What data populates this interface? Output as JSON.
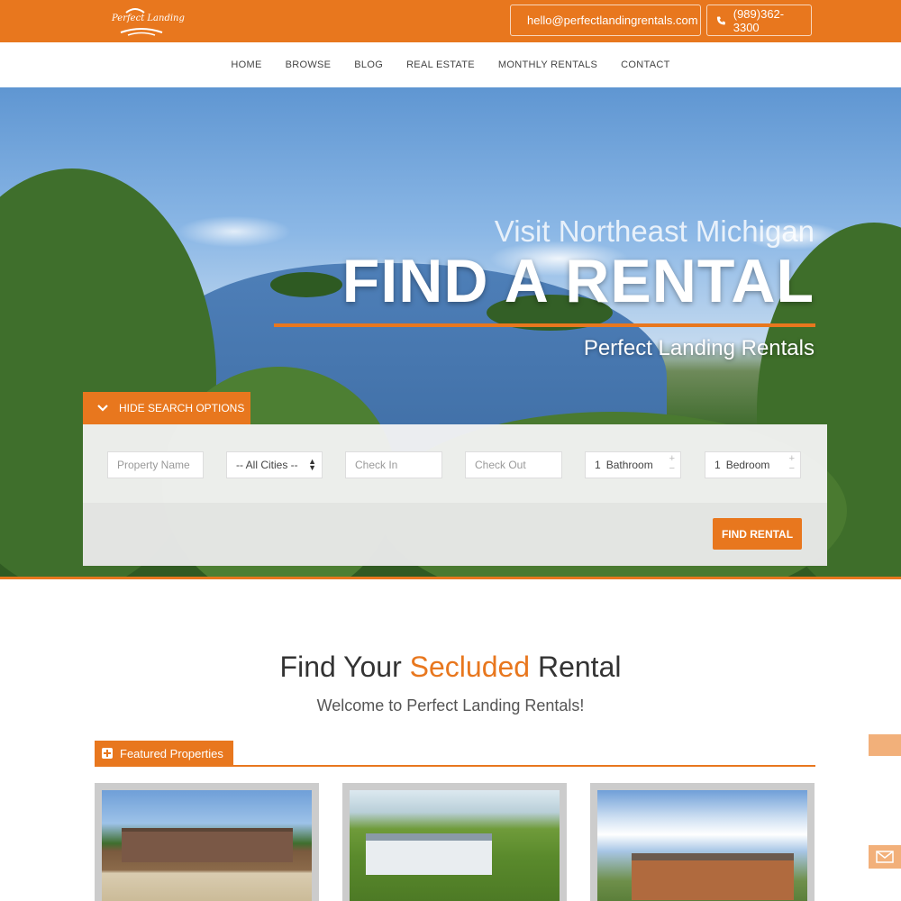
{
  "header": {
    "logo_text": "Perfect Landing",
    "email": "hello@perfectlandingrentals.com",
    "phone": "(989)362-3300"
  },
  "nav": {
    "items": [
      "HOME",
      "BROWSE",
      "BLOG",
      "REAL ESTATE",
      "MONTHLY RENTALS",
      "CONTACT"
    ]
  },
  "hero": {
    "subtitle": "Visit Northeast Michigan",
    "title": "FIND A RENTAL",
    "tagline": "Perfect Landing Rentals"
  },
  "search": {
    "toggle_label": "HIDE SEARCH OPTIONS",
    "property_name_placeholder": "Property Name",
    "city_selected": "-- All Cities --",
    "check_in_placeholder": "Check In",
    "check_out_placeholder": "Check Out",
    "bathroom_value": "1",
    "bathroom_label": "Bathroom",
    "bedroom_value": "1",
    "bedroom_label": "Bedroom",
    "submit_label": "FIND RENTAL"
  },
  "welcome": {
    "title_before": "Find Your ",
    "title_accent": "Secluded",
    "title_after": " Rental",
    "subtitle": "Welcome to Perfect Landing Rentals!"
  },
  "featured": {
    "label": "Featured Properties"
  },
  "colors": {
    "accent": "#e8771e",
    "panel": "#f3f3f3"
  }
}
